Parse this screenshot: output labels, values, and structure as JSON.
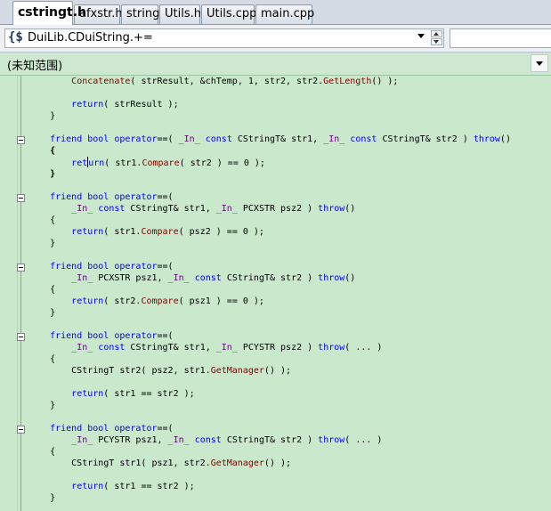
{
  "tabs": [
    {
      "label": "cstringt.h",
      "active": true
    },
    {
      "label": "afxstr.h",
      "active": false
    },
    {
      "label": "string",
      "active": false
    },
    {
      "label": "Utils.h",
      "active": false
    },
    {
      "label": "Utils.cpp",
      "active": false
    },
    {
      "label": "main.cpp",
      "active": false
    }
  ],
  "navbar": {
    "member_combo": "DuiLib.CDuiString.+=",
    "member_icon": "class-member-icon",
    "right_combo": ""
  },
  "scope": {
    "label": "(未知范围)"
  },
  "colors": {
    "editor_background": "#cae8cc",
    "keyword": "#0000ff",
    "function": "#880000",
    "macro": "#6f008a"
  },
  "code_lines": [
    [
      {
        "t": "        "
      },
      {
        "t": "Concatenate",
        "c": "fn"
      },
      {
        "t": "( strResult, &chTemp, 1, str2, str2."
      },
      {
        "t": "GetLength",
        "c": "fn"
      },
      {
        "t": "() );"
      }
    ],
    [],
    [
      {
        "t": "        "
      },
      {
        "t": "return",
        "c": "kw"
      },
      {
        "t": "( strResult );"
      }
    ],
    [
      {
        "t": "    }"
      }
    ],
    [],
    [
      {
        "t": "    "
      },
      {
        "t": "friend bool operator",
        "c": "kw"
      },
      {
        "t": "==( "
      },
      {
        "t": "_In_",
        "c": "mac"
      },
      {
        "t": " "
      },
      {
        "t": "const",
        "c": "kw"
      },
      {
        "t": " CStringT& str1, "
      },
      {
        "t": "_In_",
        "c": "mac"
      },
      {
        "t": " "
      },
      {
        "t": "const",
        "c": "kw"
      },
      {
        "t": " CStringT& str2 ) "
      },
      {
        "t": "throw",
        "c": "kw"
      },
      {
        "t": "()"
      }
    ],
    [
      {
        "t": "    {",
        "c": "brace"
      }
    ],
    [
      {
        "t": "        "
      },
      {
        "t": "ret",
        "c": "kw"
      },
      {
        "t": "",
        "c": "cursor"
      },
      {
        "t": "urn",
        "c": "kw"
      },
      {
        "t": "( str1."
      },
      {
        "t": "Compare",
        "c": "fn"
      },
      {
        "t": "( str2 ) == 0 );"
      }
    ],
    [
      {
        "t": "    }",
        "c": "brace"
      }
    ],
    [],
    [
      {
        "t": "    "
      },
      {
        "t": "friend bool operator",
        "c": "kw"
      },
      {
        "t": "==("
      }
    ],
    [
      {
        "t": "        "
      },
      {
        "t": "_In_",
        "c": "mac"
      },
      {
        "t": " "
      },
      {
        "t": "const",
        "c": "kw"
      },
      {
        "t": " CStringT& str1, "
      },
      {
        "t": "_In_",
        "c": "mac"
      },
      {
        "t": " PCXSTR psz2 ) "
      },
      {
        "t": "throw",
        "c": "kw"
      },
      {
        "t": "()"
      }
    ],
    [
      {
        "t": "    {"
      }
    ],
    [
      {
        "t": "        "
      },
      {
        "t": "return",
        "c": "kw"
      },
      {
        "t": "( str1."
      },
      {
        "t": "Compare",
        "c": "fn"
      },
      {
        "t": "( psz2 ) == 0 );"
      }
    ],
    [
      {
        "t": "    }"
      }
    ],
    [],
    [
      {
        "t": "    "
      },
      {
        "t": "friend bool operator",
        "c": "kw"
      },
      {
        "t": "==("
      }
    ],
    [
      {
        "t": "        "
      },
      {
        "t": "_In_",
        "c": "mac"
      },
      {
        "t": " PCXSTR psz1, "
      },
      {
        "t": "_In_",
        "c": "mac"
      },
      {
        "t": " "
      },
      {
        "t": "const",
        "c": "kw"
      },
      {
        "t": " CStringT& str2 ) "
      },
      {
        "t": "throw",
        "c": "kw"
      },
      {
        "t": "()"
      }
    ],
    [
      {
        "t": "    {"
      }
    ],
    [
      {
        "t": "        "
      },
      {
        "t": "return",
        "c": "kw"
      },
      {
        "t": "( str2."
      },
      {
        "t": "Compare",
        "c": "fn"
      },
      {
        "t": "( psz1 ) == 0 );"
      }
    ],
    [
      {
        "t": "    }"
      }
    ],
    [],
    [
      {
        "t": "    "
      },
      {
        "t": "friend bool operator",
        "c": "kw"
      },
      {
        "t": "==("
      }
    ],
    [
      {
        "t": "        "
      },
      {
        "t": "_In_",
        "c": "mac"
      },
      {
        "t": " "
      },
      {
        "t": "const",
        "c": "kw"
      },
      {
        "t": " CStringT& str1, "
      },
      {
        "t": "_In_",
        "c": "mac"
      },
      {
        "t": " PCYSTR psz2 ) "
      },
      {
        "t": "throw",
        "c": "kw"
      },
      {
        "t": "( ... )"
      }
    ],
    [
      {
        "t": "    {"
      }
    ],
    [
      {
        "t": "        CStringT str2( psz2, str1."
      },
      {
        "t": "GetManager",
        "c": "fn"
      },
      {
        "t": "() );"
      }
    ],
    [],
    [
      {
        "t": "        "
      },
      {
        "t": "return",
        "c": "kw"
      },
      {
        "t": "( str1 == str2 );"
      }
    ],
    [
      {
        "t": "    }"
      }
    ],
    [],
    [
      {
        "t": "    "
      },
      {
        "t": "friend bool operator",
        "c": "kw"
      },
      {
        "t": "==("
      }
    ],
    [
      {
        "t": "        "
      },
      {
        "t": "_In_",
        "c": "mac"
      },
      {
        "t": " PCYSTR psz1, "
      },
      {
        "t": "_In_",
        "c": "mac"
      },
      {
        "t": " "
      },
      {
        "t": "const",
        "c": "kw"
      },
      {
        "t": " CStringT& str2 ) "
      },
      {
        "t": "throw",
        "c": "kw"
      },
      {
        "t": "( ... )"
      }
    ],
    [
      {
        "t": "    {"
      }
    ],
    [
      {
        "t": "        CStringT str1( psz1, str2."
      },
      {
        "t": "GetManager",
        "c": "fn"
      },
      {
        "t": "() );"
      }
    ],
    [],
    [
      {
        "t": "        "
      },
      {
        "t": "return",
        "c": "kw"
      },
      {
        "t": "( str1 == str2 );"
      }
    ],
    [
      {
        "t": "    }"
      }
    ]
  ]
}
